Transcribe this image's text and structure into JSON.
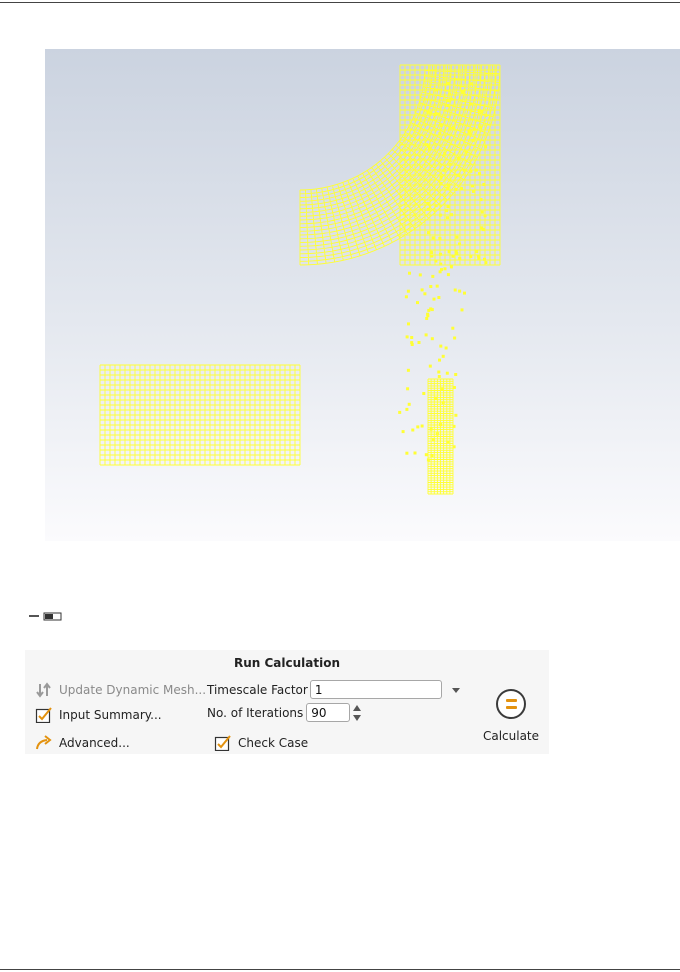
{
  "panel": {
    "title": "Run Calculation",
    "update_dynamic_mesh": "Update Dynamic Mesh...",
    "input_summary": "Input Summary...",
    "advanced": "Advanced...",
    "timescale_factor_label": "Timescale Factor",
    "timescale_factor_value": "1",
    "iterations_label": "No. of Iterations",
    "iterations_value": "90",
    "check_case_label": "Check Case",
    "check_case_checked": true,
    "calculate_label": "Calculate"
  },
  "viewport": {
    "mesh_color": "#ffff33",
    "icons": {
      "scale": "scale-bar-icon"
    }
  },
  "colors": {
    "accent": "#e3920f",
    "mesh": "#ffff33"
  }
}
